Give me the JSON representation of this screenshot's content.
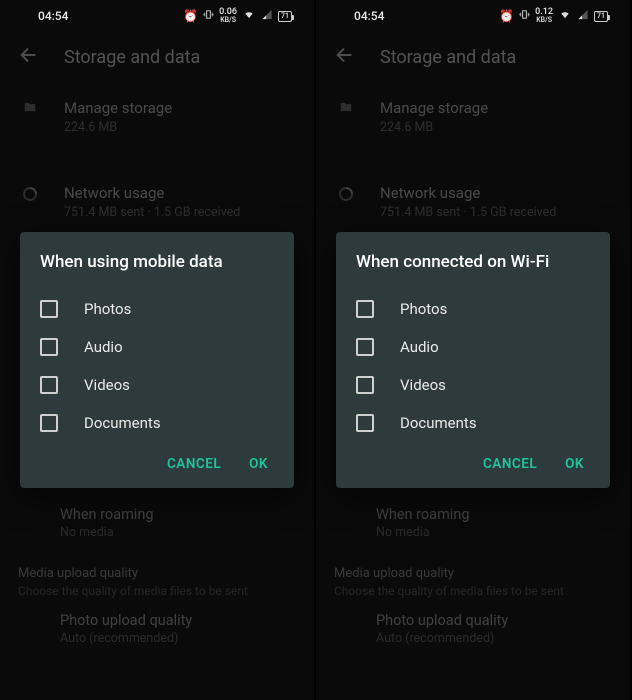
{
  "screens": [
    {
      "status": {
        "time": "04:54",
        "kbs": "0.06",
        "kbs_unit": "KB/S",
        "battery": "71"
      },
      "header": {
        "title": "Storage and data"
      },
      "manage_storage": {
        "title": "Manage storage",
        "sub": "224.6 MB"
      },
      "network_usage": {
        "title": "Network usage",
        "sub": "751.4 MB sent · 1.5 GB received"
      },
      "roaming": {
        "title": "When roaming",
        "sub": "No media"
      },
      "media_quality": {
        "title": "Media upload quality",
        "sub": "Choose the quality of media files to be sent"
      },
      "photo_quality": {
        "title": "Photo upload quality",
        "sub": "Auto (recommended)"
      },
      "dialog": {
        "title": "When using mobile data",
        "options": [
          "Photos",
          "Audio",
          "Videos",
          "Documents"
        ],
        "cancel": "CANCEL",
        "ok": "OK"
      }
    },
    {
      "status": {
        "time": "04:54",
        "kbs": "0.12",
        "kbs_unit": "KB/S",
        "battery": "71"
      },
      "header": {
        "title": "Storage and data"
      },
      "manage_storage": {
        "title": "Manage storage",
        "sub": "224.6 MB"
      },
      "network_usage": {
        "title": "Network usage",
        "sub": "751.4 MB sent · 1.5 GB received"
      },
      "roaming": {
        "title": "When roaming",
        "sub": "No media"
      },
      "media_quality": {
        "title": "Media upload quality",
        "sub": "Choose the quality of media files to be sent"
      },
      "photo_quality": {
        "title": "Photo upload quality",
        "sub": "Auto (recommended)"
      },
      "dialog": {
        "title": "When connected on Wi-Fi",
        "options": [
          "Photos",
          "Audio",
          "Videos",
          "Documents"
        ],
        "cancel": "CANCEL",
        "ok": "OK"
      }
    }
  ]
}
